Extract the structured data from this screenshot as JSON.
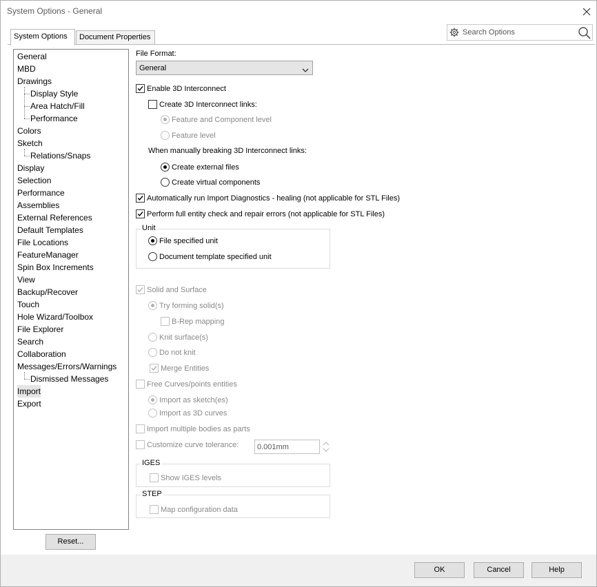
{
  "window": {
    "title": "System Options - General"
  },
  "tabs": [
    {
      "label": "System Options",
      "active": true
    },
    {
      "label": "Document Properties",
      "active": false
    }
  ],
  "search": {
    "placeholder": "Search Options"
  },
  "tree": {
    "items": [
      {
        "label": "General",
        "level": 0
      },
      {
        "label": "MBD",
        "level": 0
      },
      {
        "label": "Drawings",
        "level": 0
      },
      {
        "label": "Display Style",
        "level": 1
      },
      {
        "label": "Area Hatch/Fill",
        "level": 1
      },
      {
        "label": "Performance",
        "level": 1
      },
      {
        "label": "Colors",
        "level": 0
      },
      {
        "label": "Sketch",
        "level": 0
      },
      {
        "label": "Relations/Snaps",
        "level": 1
      },
      {
        "label": "Display",
        "level": 0
      },
      {
        "label": "Selection",
        "level": 0
      },
      {
        "label": "Performance",
        "level": 0
      },
      {
        "label": "Assemblies",
        "level": 0
      },
      {
        "label": "External References",
        "level": 0
      },
      {
        "label": "Default Templates",
        "level": 0
      },
      {
        "label": "File Locations",
        "level": 0
      },
      {
        "label": "FeatureManager",
        "level": 0
      },
      {
        "label": "Spin Box Increments",
        "level": 0
      },
      {
        "label": "View",
        "level": 0
      },
      {
        "label": "Backup/Recover",
        "level": 0
      },
      {
        "label": "Touch",
        "level": 0
      },
      {
        "label": "Hole Wizard/Toolbox",
        "level": 0
      },
      {
        "label": "File Explorer",
        "level": 0
      },
      {
        "label": "Search",
        "level": 0
      },
      {
        "label": "Collaboration",
        "level": 0
      },
      {
        "label": "Messages/Errors/Warnings",
        "level": 0
      },
      {
        "label": "Dismissed Messages",
        "level": 1
      },
      {
        "label": "Import",
        "level": 0,
        "selected": true
      },
      {
        "label": "Export",
        "level": 0
      }
    ]
  },
  "reset_label": "Reset...",
  "form": {
    "file_format_label": "File Format:",
    "file_format_value": "General",
    "enable_3d_interconnect": "Enable 3D Interconnect",
    "create_links": "Create 3D Interconnect links:",
    "feature_component_level": "Feature and Component level",
    "feature_level": "Feature level",
    "manual_break_label": "When manually breaking 3D Interconnect links:",
    "create_external_files": "Create external files",
    "create_virtual_components": "Create virtual components",
    "auto_import_diag": "Automatically run Import Diagnostics - healing (not applicable for STL Files)",
    "full_entity_check": "Perform full entity check and repair errors (not applicable for STL Files)",
    "unit_group": "Unit",
    "file_specified_unit": "File specified unit",
    "doc_template_unit": "Document template specified unit",
    "solid_surface": "Solid and Surface",
    "try_forming_solids": "Try forming solid(s)",
    "brep_mapping": "B-Rep mapping",
    "knit_surfaces": "Knit surface(s)",
    "do_not_knit": "Do not knit",
    "merge_entities": "Merge Entities",
    "free_curves": "Free Curves/points entities",
    "import_as_sketch": "Import as sketch(es)",
    "import_as_3d_curves": "Import as 3D curves",
    "import_multiple_bodies": "Import multiple bodies as parts",
    "customize_curve_tol": "Customize curve tolerance:",
    "curve_tol_value": "0.001mm",
    "iges_group": "IGES",
    "show_iges_levels": "Show IGES levels",
    "step_group": "STEP",
    "map_config_data": "Map configuration data"
  },
  "buttons": {
    "ok": "OK",
    "cancel": "Cancel",
    "help": "Help"
  }
}
